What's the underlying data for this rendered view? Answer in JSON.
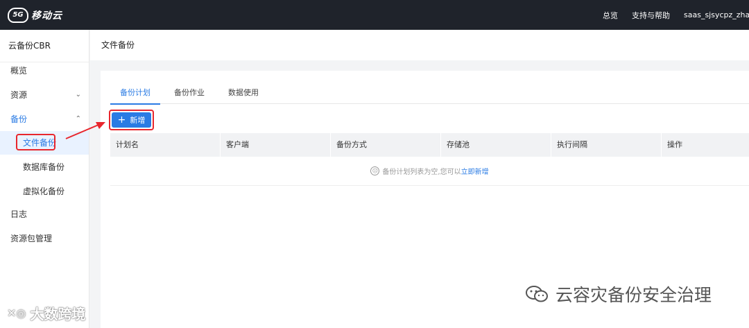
{
  "topbar": {
    "logo_mark": "5G",
    "logo_text": "移动云",
    "links": [
      "总览",
      "支持与帮助"
    ],
    "user": "saas_sjsycpz_zhan"
  },
  "sidebar": {
    "title": "云备份CBR",
    "items": [
      {
        "label": "概览"
      },
      {
        "label": "资源",
        "chevron": "chevron-down-icon"
      },
      {
        "label": "备份",
        "chevron": "chevron-up-icon"
      },
      {
        "label": "文件备份"
      },
      {
        "label": "数据库备份"
      },
      {
        "label": "虚拟化备份"
      },
      {
        "label": "日志"
      },
      {
        "label": "资源包管理"
      }
    ]
  },
  "header": {
    "title": "文件备份"
  },
  "tabs": [
    "备份计划",
    "备份作业",
    "数据使用"
  ],
  "add_button": {
    "icon": "plus-icon",
    "label": "新增"
  },
  "table": {
    "columns": [
      "计划名",
      "客户端",
      "备份方式",
      "存储池",
      "执行间隔",
      "操作"
    ],
    "empty_text": "备份计划列表为空,您可以",
    "empty_link": "立即新增"
  },
  "watermarks": {
    "left": "大数跨境",
    "right": "云容灾备份安全治理"
  },
  "colors": {
    "accent": "#2a7be4",
    "topbar": "#1f232b",
    "highlight": "#e8262d"
  }
}
